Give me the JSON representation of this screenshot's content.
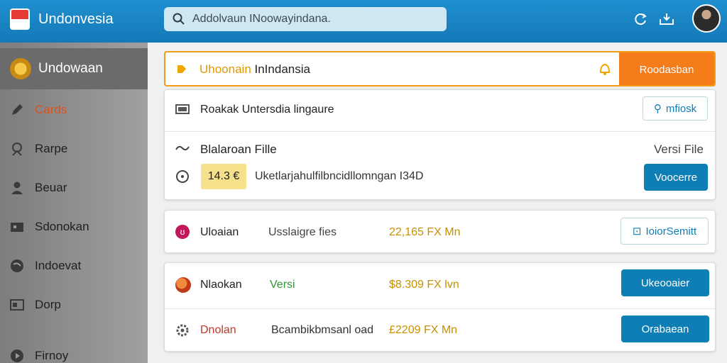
{
  "app": {
    "brand": "Undonvesia"
  },
  "search": {
    "text": "Addolvaun INoowayindana."
  },
  "sidebar": {
    "header": "Undowaan",
    "items": [
      {
        "label": "Cards",
        "icon": "pen-icon",
        "active": true
      },
      {
        "label": "Rarpe",
        "icon": "user-pin-icon"
      },
      {
        "label": "Beuar",
        "icon": "person-icon"
      },
      {
        "label": "Sdonokan",
        "icon": "folder-icon"
      },
      {
        "label": "Indoevat",
        "icon": "globe-icon"
      },
      {
        "label": "Dorp",
        "icon": "card-icon"
      },
      {
        "label": "Firnoy",
        "icon": "play-icon"
      }
    ]
  },
  "banner": {
    "title_prefix": "Uhoonain",
    "title_suffix": " InIndansia",
    "button": "Roodasban"
  },
  "card1": {
    "row1_text": "Roakak Untersdia lingaure",
    "row1_button": "mfiosk",
    "row2_title": "Blalaroan Fille",
    "row2_right": "Versi File",
    "row3_badge": "14.3 €",
    "row3_text": "Uketlarjahulfilbncidllomngan I34D",
    "row3_button": "Voocerre"
  },
  "card2": {
    "name": "Uloaian",
    "desc": "Usslaigre fies",
    "amount": "22,165 FX Mn",
    "button": "IoiorSemitt"
  },
  "card3": {
    "rows": [
      {
        "name": "Nlaokan",
        "desc": "Versi",
        "amount": "$8.309 FX lvn",
        "button": "Ukeooaier"
      },
      {
        "name": "Dnolan",
        "desc": "Bcambikbmsanl oad",
        "amount": "£2209 FX Mn",
        "button": "Orabaean"
      }
    ]
  },
  "colors": {
    "topbar": "#1479b8",
    "accent_orange": "#f57c1a",
    "button_blue": "#0e7fb6",
    "active_item": "#d9531e"
  }
}
